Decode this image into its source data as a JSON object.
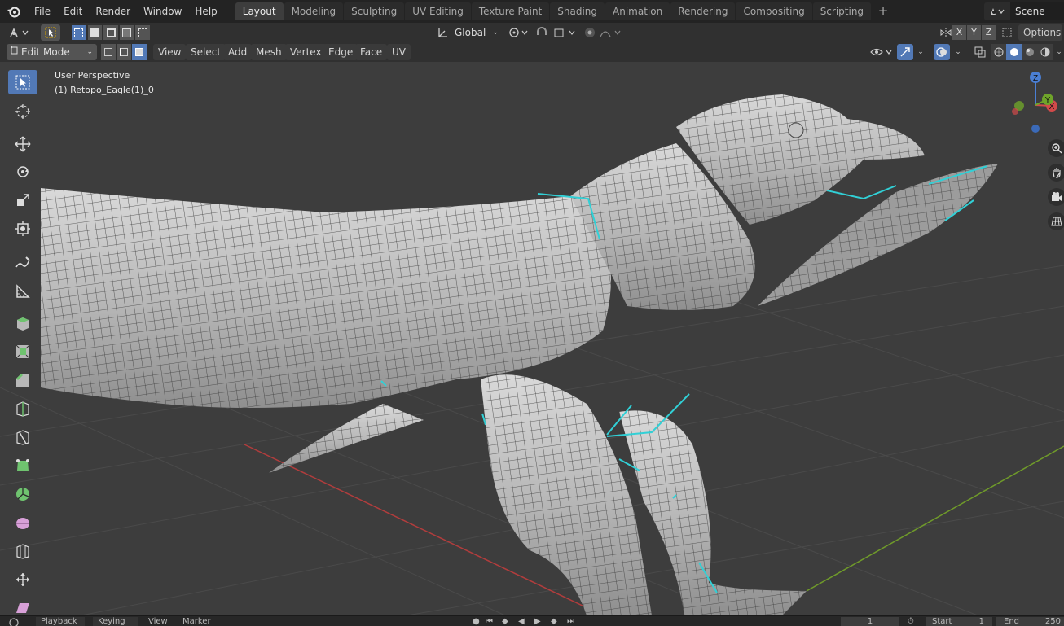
{
  "menubar": {
    "items": [
      "File",
      "Edit",
      "Render",
      "Window",
      "Help"
    ]
  },
  "workspaces": {
    "tabs": [
      "Layout",
      "Modeling",
      "Sculpting",
      "UV Editing",
      "Texture Paint",
      "Shading",
      "Animation",
      "Rendering",
      "Compositing",
      "Scripting"
    ],
    "active": "Layout",
    "add_symbol": "+"
  },
  "scene": {
    "label": "Scene"
  },
  "tool_settings": {
    "orientation": "Global",
    "axes": [
      "X",
      "Y",
      "Z"
    ],
    "options_label": "Options"
  },
  "header": {
    "mode": "Edit Mode",
    "menus": [
      "View",
      "Select",
      "Add",
      "Mesh",
      "Vertex",
      "Edge",
      "Face",
      "UV"
    ]
  },
  "viewport": {
    "perspective": "User Perspective",
    "object": "(1) Retopo_Eagle(1)_0"
  },
  "gizmo": {
    "z": "Z",
    "y": "Y",
    "x": "X"
  },
  "timeline": {
    "items": [
      "Playback",
      "Keying",
      "View",
      "Marker"
    ],
    "current_frame": "1",
    "start_label": "Start",
    "start_value": "1",
    "end_label": "End",
    "end_value": "250"
  },
  "colors": {
    "accent": "#5279b6",
    "selection": "#31d0d6",
    "x_axis": "#b13d3d",
    "y_axis": "#6f9a2a",
    "viewport_bg": "#3d3d3d"
  }
}
